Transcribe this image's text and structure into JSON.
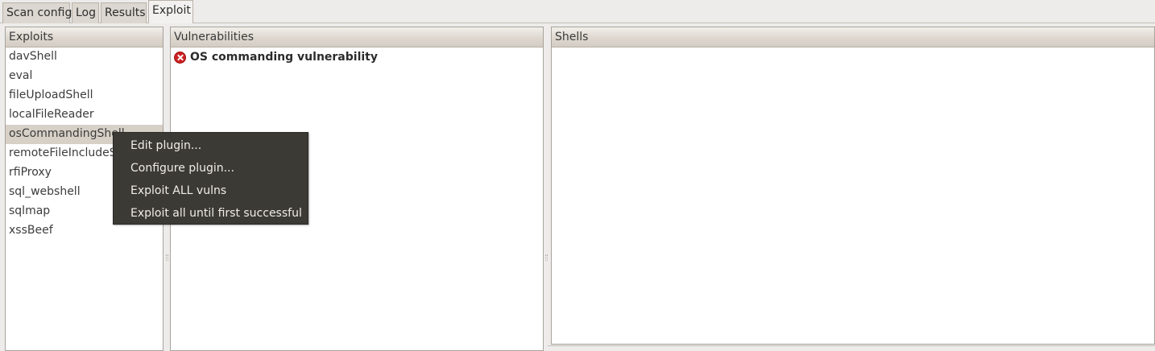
{
  "tabs": [
    {
      "label": "Scan config"
    },
    {
      "label": "Log"
    },
    {
      "label": "Results"
    },
    {
      "label": "Exploit"
    }
  ],
  "active_tab": "Exploit",
  "exploits_panel": {
    "header": "Exploits",
    "items": [
      {
        "label": "davShell"
      },
      {
        "label": "eval"
      },
      {
        "label": "fileUploadShell"
      },
      {
        "label": "localFileReader"
      },
      {
        "label": "osCommandingShell"
      },
      {
        "label": "remoteFileIncludeShell"
      },
      {
        "label": "rfiProxy"
      },
      {
        "label": "sql_webshell"
      },
      {
        "label": "sqlmap"
      },
      {
        "label": "xssBeef"
      }
    ],
    "selected_item": "osCommandingShell"
  },
  "vulnerabilities_panel": {
    "header": "Vulnerabilities",
    "items": [
      {
        "label": "OS commanding vulnerability",
        "icon": "error-icon"
      }
    ]
  },
  "shells_panel": {
    "header": "Shells"
  },
  "context_menu": {
    "items": [
      {
        "label": "Edit plugin..."
      },
      {
        "label": "Configure plugin..."
      },
      {
        "label": "Exploit ALL vulns"
      },
      {
        "label": "Exploit all until first successful"
      }
    ]
  },
  "colors": {
    "menu_background": "#3b3a35",
    "selection": "#d6d0c6",
    "error_icon": "#cc1f1f"
  }
}
